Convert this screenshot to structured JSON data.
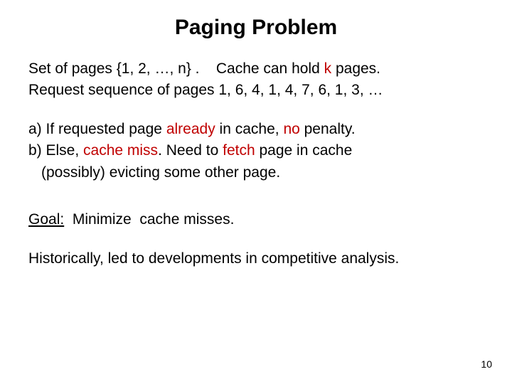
{
  "title": "Paging Problem",
  "intro": {
    "l1_a": "Set of pages {1, 2, …, n} .",
    "l1_gap": "    ",
    "l1_b": "Cache can hold ",
    "l1_k": "k",
    "l1_c": " pages.",
    "l2": "Request sequence of pages 1, 6, 4, 1, 4, 7, 6, 1, 3, …"
  },
  "rules": {
    "a_prefix": "a) If requested page ",
    "a_already": "already",
    "a_mid": " in cache, ",
    "a_no": "no",
    "a_suffix": " penalty.",
    "b_prefix": "b) Else, ",
    "b_miss": "cache miss",
    "b_mid": ". Need to ",
    "b_fetch": "fetch",
    "b_suffix": " page in cache",
    "b_line2": "(possibly) evicting some other page."
  },
  "goal": {
    "label": "Goal:",
    "text": "  Minimize  cache misses."
  },
  "history": "Historically, led to developments in competitive analysis.",
  "pagenum": "10"
}
